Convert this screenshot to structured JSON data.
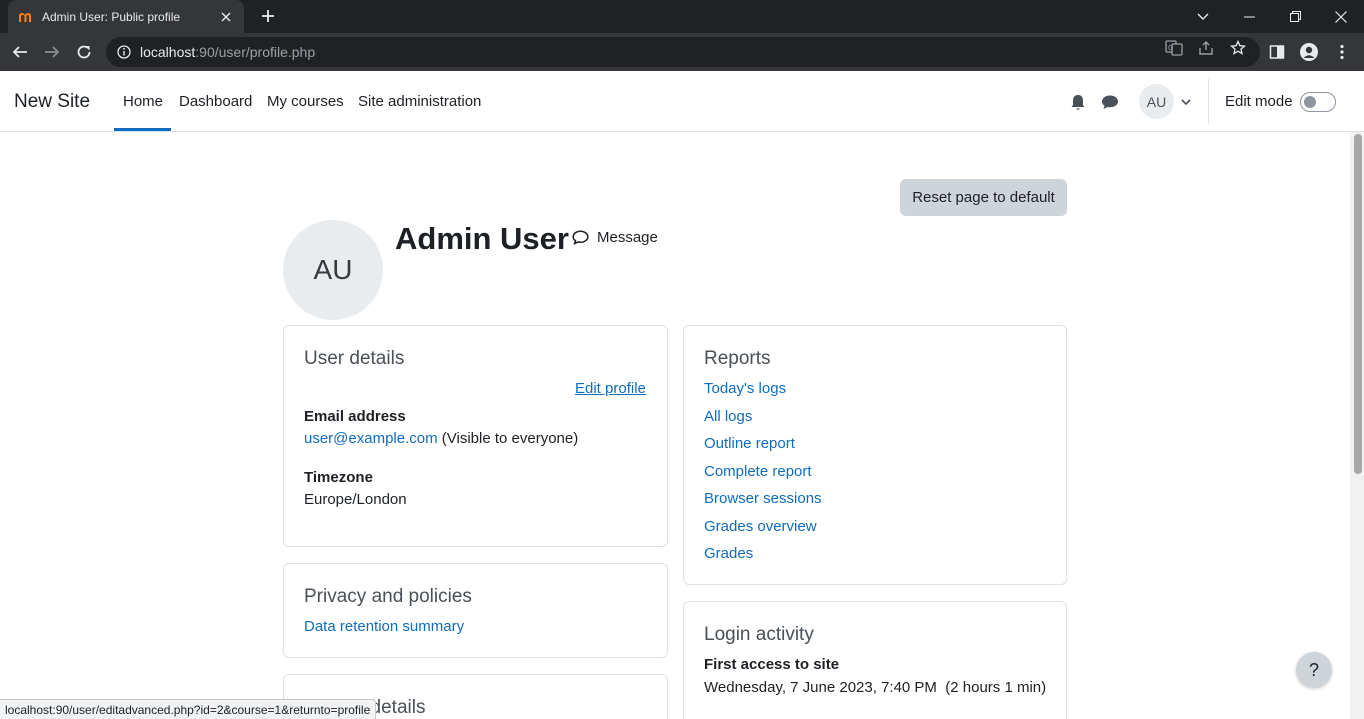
{
  "browser": {
    "tab_title": "Admin User: Public profile",
    "url_host": "localhost",
    "url_rest": ":90/user/profile.php",
    "status_url": "localhost:90/user/editadvanced.php?id=2&course=1&returnto=profile"
  },
  "navbar": {
    "brand": "New Site",
    "links": [
      "Home",
      "Dashboard",
      "My courses",
      "Site administration"
    ],
    "active": "Home",
    "user_initials": "AU",
    "edit_mode_label": "Edit mode",
    "edit_mode_on": false
  },
  "profile": {
    "reset_button": "Reset page to default",
    "avatar_initials": "AU",
    "name": "Admin User",
    "message_label": "Message"
  },
  "user_details": {
    "title": "User details",
    "edit_profile": "Edit profile",
    "email_label": "Email address",
    "email_value": "user@example.com",
    "email_visibility": "(Visible to everyone)",
    "timezone_label": "Timezone",
    "timezone_value": "Europe/London"
  },
  "privacy": {
    "title": "Privacy and policies",
    "link": "Data retention summary"
  },
  "course_details": {
    "title": "Course details"
  },
  "reports": {
    "title": "Reports",
    "links": [
      "Today's logs",
      "All logs",
      "Outline report",
      "Complete report",
      "Browser sessions",
      "Grades overview",
      "Grades"
    ]
  },
  "login_activity": {
    "title": "Login activity",
    "first_access_label": "First access to site",
    "first_access_value": "Wednesday, 7 June 2023, 7:40 PM  (2 hours 1 min)"
  },
  "help_button": "?",
  "colors": {
    "link": "#0f6cbf",
    "chrome_dark": "#202124",
    "chrome_toolbar": "#35363a"
  }
}
